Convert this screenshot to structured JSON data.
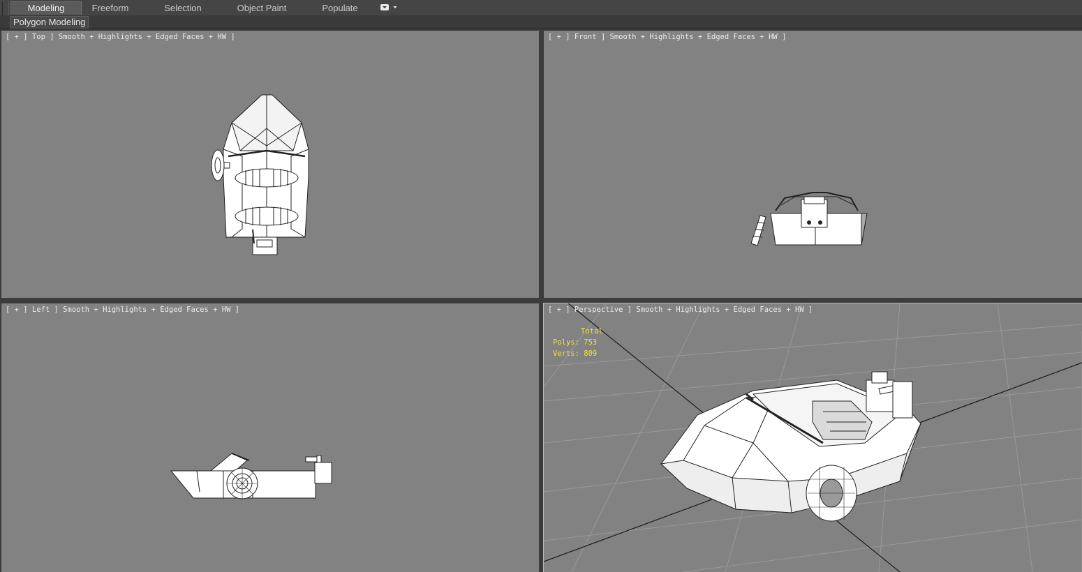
{
  "ribbon": {
    "tabs": [
      "Modeling",
      "Freeform",
      "Selection",
      "Object Paint",
      "Populate"
    ],
    "active_tab": "Modeling",
    "panel_label": "Polygon Modeling"
  },
  "viewports": {
    "top": {
      "label": "[ + ] Top ] Smooth + Highlights + Edged Faces + HW ]"
    },
    "front": {
      "label": "[ + ] Front ] Smooth + Highlights + Edged Faces + HW ]"
    },
    "left": {
      "label": "[ + ] Left ] Smooth + Highlights + Edged Faces + HW ]"
    },
    "perspective": {
      "label": "[ + ] Perspective ] Smooth + Highlights + Edged Faces + HW ]",
      "stats": {
        "title": "Total",
        "polys": "Polys: 753",
        "verts": "Verts: 809"
      }
    }
  },
  "colors": {
    "viewport_bg": "#828282",
    "stats_text": "#f2e33c",
    "ui_dark": "#3c3c3c"
  }
}
